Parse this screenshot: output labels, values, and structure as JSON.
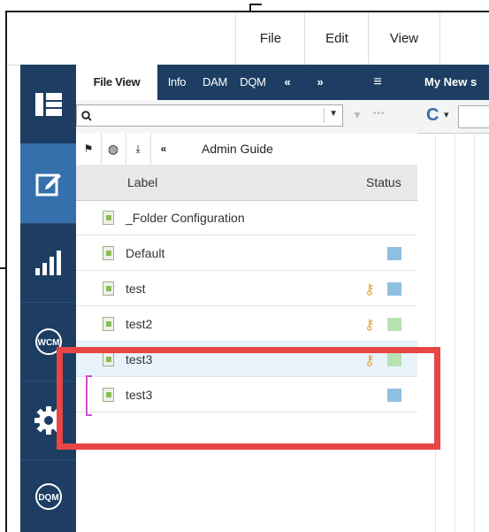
{
  "menubar": {
    "items": [
      {
        "label": "File"
      },
      {
        "label": "Edit"
      },
      {
        "label": "View"
      }
    ]
  },
  "leftnav": {
    "items": [
      {
        "name": "dashboard-icon"
      },
      {
        "name": "edit-icon",
        "active": true
      },
      {
        "name": "bar-chart-icon"
      },
      {
        "name": "wcm-icon",
        "label": "WCM"
      },
      {
        "name": "gear-icon"
      },
      {
        "name": "dqm-icon",
        "label": "DQM"
      }
    ]
  },
  "tabs": [
    {
      "label": "File View",
      "active": true
    },
    {
      "label": "Info"
    },
    {
      "label": "DAM"
    },
    {
      "label": "DQM"
    },
    {
      "label": "«"
    },
    {
      "label": "»"
    },
    {
      "label": "≡"
    }
  ],
  "search": {
    "value": "",
    "dropdown_glyph": "▼",
    "filter_glyph": "▼",
    "more_glyph": "•••"
  },
  "pathbar": {
    "buttons": [
      {
        "name": "flag-icon",
        "glyph": "⚑"
      },
      {
        "name": "globe-icon",
        "glyph": "◍"
      },
      {
        "name": "collapse-icon",
        "glyph": "⤓"
      },
      {
        "name": "back-icon",
        "glyph": "«"
      }
    ],
    "breadcrumb": "Admin Guide"
  },
  "columns": {
    "label": "Label",
    "status": "Status"
  },
  "rows": [
    {
      "label": "_Folder Configuration",
      "status": null,
      "key": false,
      "selected": false
    },
    {
      "label": "Default",
      "status": "#8fbfe0",
      "key": false,
      "selected": false
    },
    {
      "label": "test",
      "status": "#8fbfe0",
      "key": true,
      "selected": false
    },
    {
      "label": "test2",
      "status": "#b8e3b0",
      "key": true,
      "selected": false
    },
    {
      "label": "test3",
      "status": "#b8e3b0",
      "key": true,
      "selected": true
    },
    {
      "label": "test3",
      "status": "#8fbfe0",
      "key": false,
      "selected": false
    }
  ],
  "right_panel": {
    "tab": "My New s",
    "refresh_glyph": "C",
    "dropdown_glyph": "▾"
  },
  "colors": {
    "nav_bg": "#1d3e62",
    "nav_active": "#3570ad",
    "highlight": "#e84545",
    "bracket": "#d14fd1"
  }
}
